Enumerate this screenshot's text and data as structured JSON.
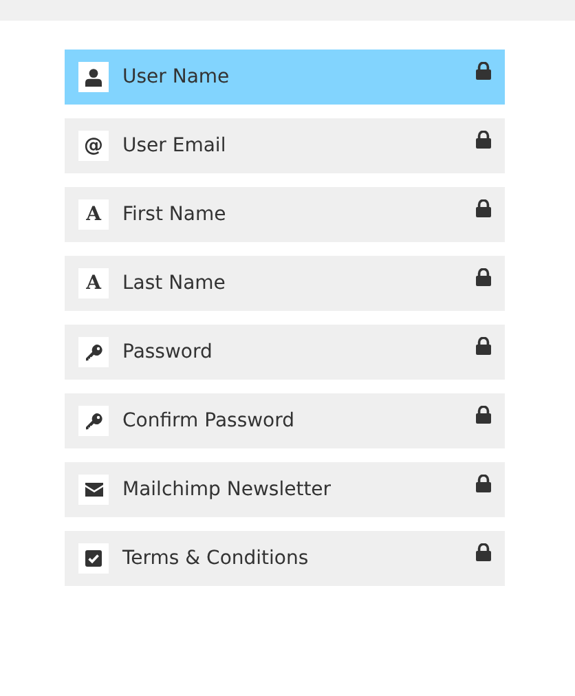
{
  "fields": [
    {
      "kind": "user",
      "label": "User Name",
      "selected": true,
      "locked": true
    },
    {
      "kind": "char",
      "icon": "@",
      "label": "User Email",
      "selected": false,
      "locked": true
    },
    {
      "kind": "char",
      "icon": "A",
      "label": "First Name",
      "selected": false,
      "locked": true
    },
    {
      "kind": "char",
      "icon": "A",
      "label": "Last Name",
      "selected": false,
      "locked": true
    },
    {
      "kind": "key",
      "label": "Password",
      "selected": false,
      "locked": true
    },
    {
      "kind": "key",
      "label": "Confirm Password",
      "selected": false,
      "locked": true
    },
    {
      "kind": "mail",
      "label": "Mailchimp Newsletter",
      "selected": false,
      "locked": true
    },
    {
      "kind": "check",
      "label": "Terms & Conditions",
      "selected": false,
      "locked": true
    }
  ]
}
